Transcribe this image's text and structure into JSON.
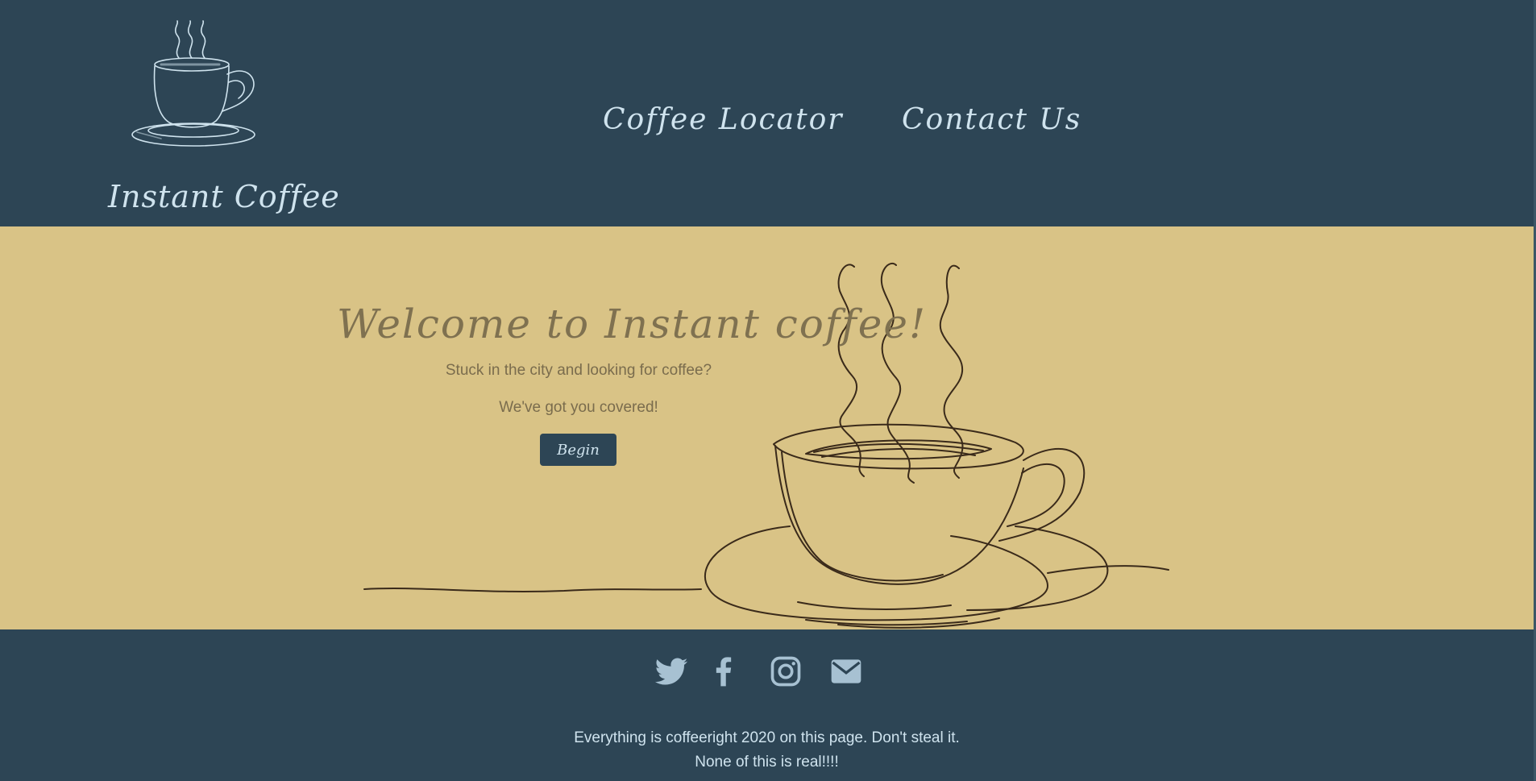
{
  "header": {
    "brand": "Instant Coffee",
    "nav": [
      {
        "label": "Coffee Locator"
      },
      {
        "label": "Contact Us"
      }
    ]
  },
  "hero": {
    "title": "Welcome to Instant coffee!",
    "line1": "Stuck in the city and looking for coffee?",
    "line2": "We've got you covered!",
    "button": "Begin"
  },
  "footer": {
    "social_icons": [
      "twitter-icon",
      "facebook-icon",
      "instagram-icon",
      "email-icon"
    ],
    "copyright": "Everything is coffeeright 2020 on this page. Don't steal it.",
    "disclaimer": "None of this is real!!!!"
  },
  "colors": {
    "header_bg": "#2d4555",
    "hero_bg": "#d9c386",
    "accent_text": "#cfe3ee",
    "hero_text": "#7f7150"
  }
}
